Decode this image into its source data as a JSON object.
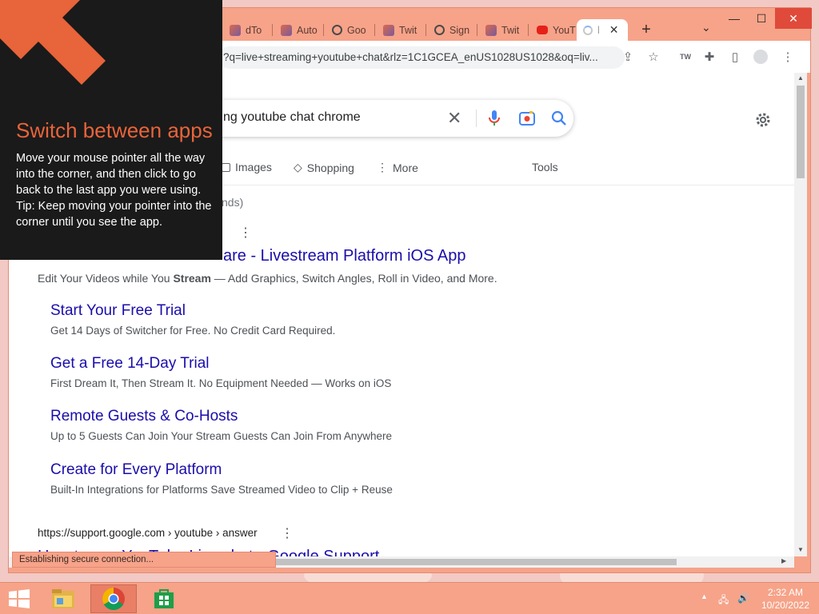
{
  "browser": {
    "tabs": [
      {
        "label": "dTo",
        "icon": "cloud-tab-icon"
      },
      {
        "label": "Auto",
        "icon": "cloud-tab-icon"
      },
      {
        "label": "Goo",
        "icon": "google-tab-icon"
      },
      {
        "label": "Twit",
        "icon": "cloud-tab-icon"
      },
      {
        "label": "Sign",
        "icon": "google-tab-icon"
      },
      {
        "label": "Twit",
        "icon": "cloud-tab-icon"
      },
      {
        "label": "YouT",
        "icon": "youtube-tab-icon"
      },
      {
        "label": "l",
        "icon": "loading-spinner-icon"
      }
    ],
    "new_tab": "+",
    "url": "?q=live+streaming+youtube+chat&rlz=1C1GCEA_enUS1028US1028&oq=liv...",
    "status": "Establishing secure connection..."
  },
  "search": {
    "query": "ng youtube chat chrome",
    "tabs": [
      {
        "label": "Images",
        "icon": "image-icon"
      },
      {
        "label": "Shopping",
        "icon": "tag-icon"
      },
      {
        "label": "More",
        "icon": "more-vertical-icon"
      }
    ],
    "tools": "Tools",
    "stats": "nds)"
  },
  "ad": {
    "title": "are - Livestream Platform iOS App",
    "desc_pre": "Edit Your Videos while You ",
    "desc_bold": "Stream",
    "desc_post": " — Add Graphics, Switch Angles, Roll in Video, and More.",
    "sitelinks": [
      {
        "title": "Start Your Free Trial",
        "desc": "Get 14 Days of Switcher for Free. No Credit Card Required."
      },
      {
        "title": "Get a Free 14-Day Trial",
        "desc": "First Dream It, Then Stream It. No Equipment Needed — Works on iOS"
      },
      {
        "title": "Remote Guests & Co-Hosts",
        "desc": "Up to 5 Guests Can Join Your Stream Guests Can Join From Anywhere"
      },
      {
        "title": "Create for Every Platform",
        "desc": "Built-In Integrations for Platforms Save Streamed Video to Clip + Reuse"
      }
    ]
  },
  "result": {
    "breadcrumb": "https://support.google.com › youtube › answer",
    "title": "How to use YouTube Live chat - Google Support"
  },
  "tip": {
    "title": "Switch between apps",
    "body": "Move your mouse pointer all the way into the corner, and then click to go back to the last app you were using.",
    "tip": "Tip: Keep moving your pointer into the corner until you see the app."
  },
  "taskbar": {
    "time": "2:32 AM",
    "date": "10/20/2022"
  },
  "colors": {
    "accent": "#e8643a",
    "window_frame": "#f6a389",
    "link": "#1a0dab"
  }
}
